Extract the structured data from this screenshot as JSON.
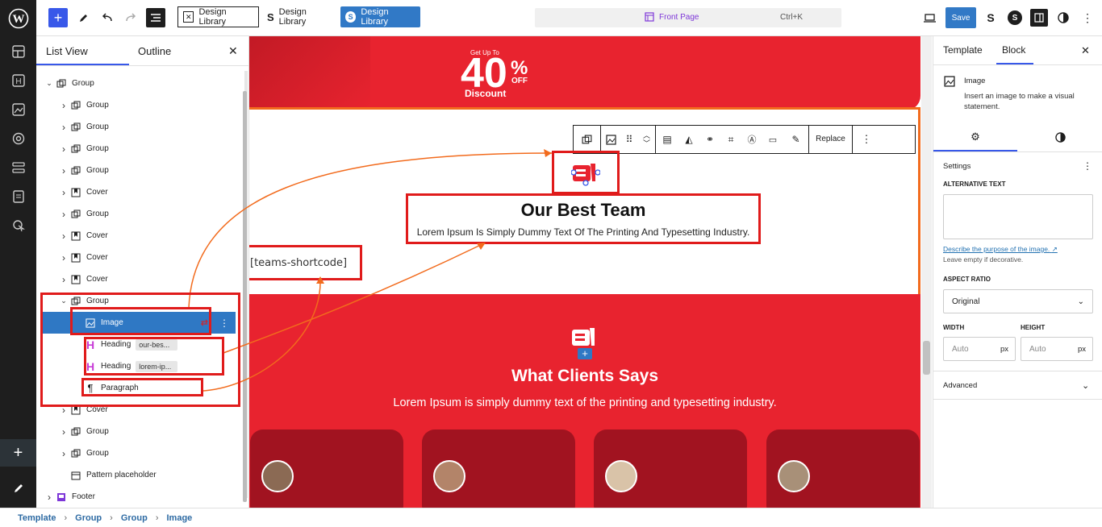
{
  "topbar": {
    "design_library_1": "Design Library",
    "design_library_2": "Design Library",
    "design_library_3": "Design Library",
    "page_title": "Front Page",
    "shortcut": "Ctrl+K",
    "save": "Save"
  },
  "listview": {
    "tab_list": "List View",
    "tab_outline": "Outline",
    "rows": [
      {
        "label": "Group",
        "chip": ""
      },
      {
        "label": "Group",
        "chip": ""
      },
      {
        "label": "Group",
        "chip": ""
      },
      {
        "label": "Group",
        "chip": ""
      },
      {
        "label": "Group",
        "chip": ""
      },
      {
        "label": "Cover",
        "chip": ""
      },
      {
        "label": "Group",
        "chip": ""
      },
      {
        "label": "Cover",
        "chip": ""
      },
      {
        "label": "Cover",
        "chip": ""
      },
      {
        "label": "Cover",
        "chip": ""
      },
      {
        "label": "Group",
        "chip": ""
      },
      {
        "label": "Image",
        "chip": ""
      },
      {
        "label": "Heading",
        "chip": "our-bes..."
      },
      {
        "label": "Heading",
        "chip": "lorem-ip..."
      },
      {
        "label": "Paragraph",
        "chip": ""
      },
      {
        "label": "Cover",
        "chip": ""
      },
      {
        "label": "Group",
        "chip": ""
      },
      {
        "label": "Group",
        "chip": ""
      },
      {
        "label": "Pattern placeholder",
        "chip": ""
      },
      {
        "label": "Footer",
        "chip": ""
      }
    ]
  },
  "canvas": {
    "promo_small": "Get Up To",
    "promo_big": "40",
    "promo_pct": "%",
    "promo_off": "OFF",
    "promo_discount": "Discount",
    "replace": "Replace",
    "team_title": "Our Best Team",
    "team_sub": "Lorem Ipsum Is Simply Dummy Text Of The Printing And Typesetting Industry.",
    "shortcode": "[teams-shortcode]",
    "clients_title": "What Clients Says",
    "clients_sub": "Lorem Ipsum is simply dummy text of the printing and typesetting industry."
  },
  "inspector": {
    "tab_template": "Template",
    "tab_block": "Block",
    "block_name": "Image",
    "block_desc": "Insert an image to make a visual statement.",
    "settings": "Settings",
    "alt_label": "ALTERNATIVE TEXT",
    "alt_link": "Describe the purpose of the image.",
    "alt_help": "Leave empty if decorative.",
    "aspect_label": "ASPECT RATIO",
    "aspect_value": "Original",
    "width_label": "WIDTH",
    "height_label": "HEIGHT",
    "width_placeholder": "Auto",
    "height_placeholder": "Auto",
    "unit": "px",
    "advanced": "Advanced"
  },
  "breadcrumb": [
    "Template",
    "Group",
    "Group",
    "Image"
  ],
  "colors": {
    "accent": "#3858e9",
    "brand_red": "#e8232f",
    "highlight": "#e01b1b",
    "arrow": "#f26b1d",
    "selected_row": "#2f78c4"
  }
}
